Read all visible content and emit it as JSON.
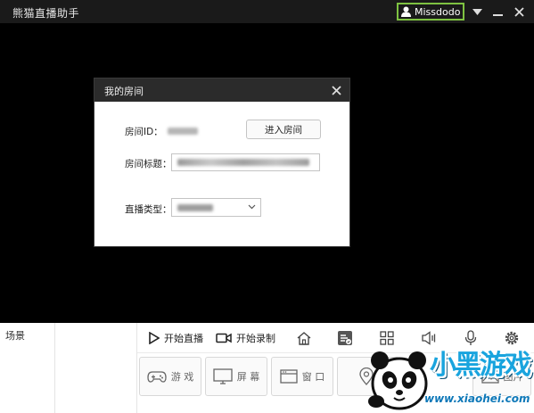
{
  "titlebar": {
    "app_title": "熊猫直播助手",
    "username": "Missdodo",
    "icons": {
      "user": "user-icon",
      "menu": "dropdown-triangle-icon",
      "minimize": "minimize-icon",
      "close": "close-icon"
    },
    "accent_color": "#7ec241"
  },
  "dialog": {
    "title": "我的房间",
    "room_id_label": "房间ID：",
    "enter_room_button": "进入房间",
    "room_title_label": "房间标题：",
    "live_type_label": "直播类型："
  },
  "bottom": {
    "scene_label": "场景",
    "start_live": "开始直播",
    "start_record": "开始录制",
    "toolbar_icons": [
      "home-icon",
      "danmaku-icon",
      "grid-icon",
      "speaker-icon",
      "microphone-icon",
      "settings-icon"
    ],
    "sources": [
      {
        "label": "游 戏",
        "icon": "gamepad-icon"
      },
      {
        "label": "屏 幕",
        "icon": "monitor-icon"
      },
      {
        "label": "窗 口",
        "icon": "window-icon"
      },
      {
        "label": "",
        "icon": "location-icon"
      },
      {
        "label": "图片",
        "icon": "picture-icon"
      }
    ]
  },
  "watermark": {
    "brand": "小黑游戏",
    "url": "www.xiaohei.com"
  }
}
